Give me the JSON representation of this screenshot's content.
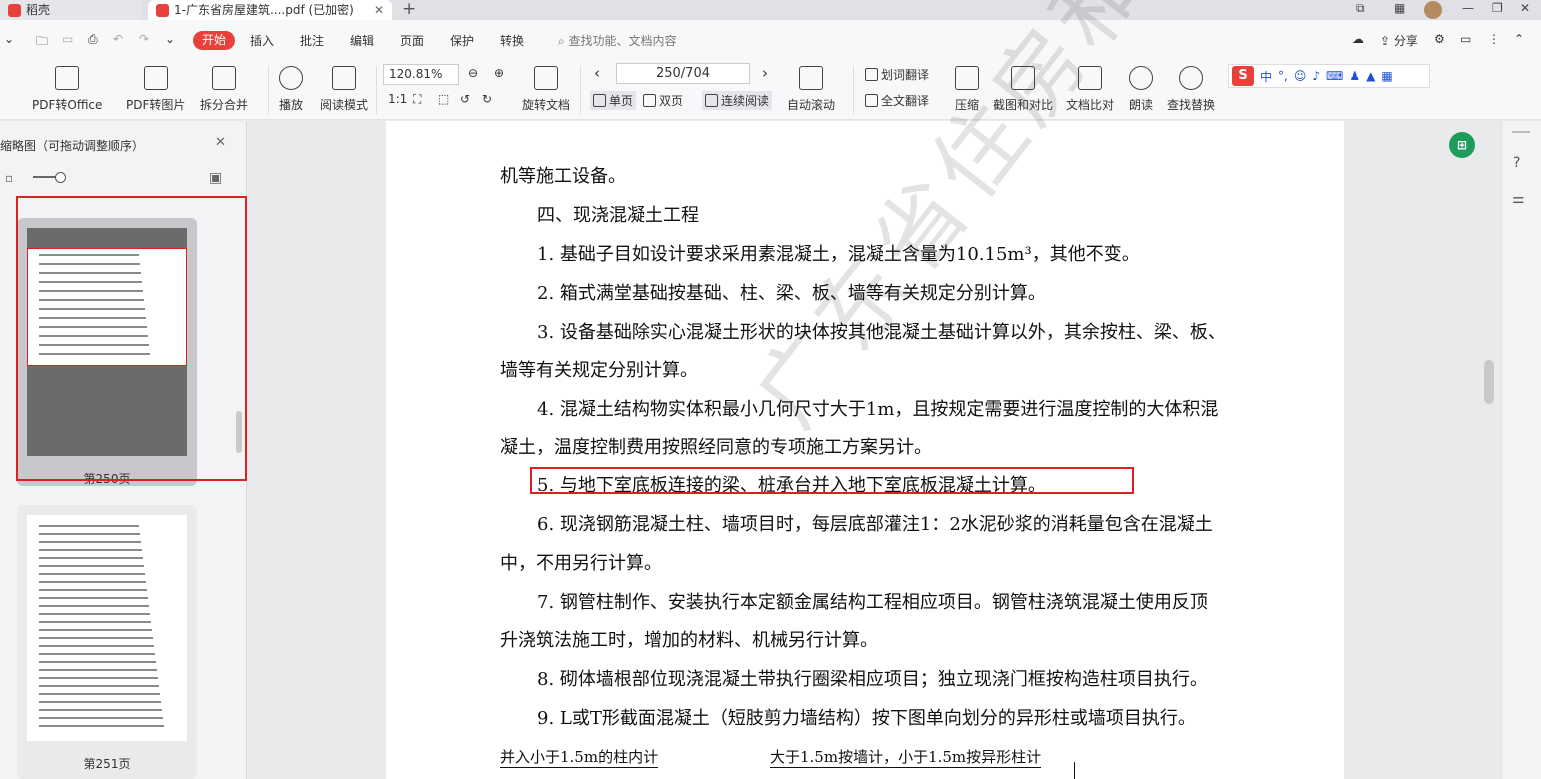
{
  "tabs": {
    "app": "稻壳",
    "document": "1-广东省房屋建筑....pdf (已加密)"
  },
  "menu": [
    "开始",
    "插入",
    "批注",
    "编辑",
    "页面",
    "保护",
    "转换"
  ],
  "search_placeholder": "查找功能、文档内容",
  "share_label": "分享",
  "toolbar": {
    "pdf_to_office": "PDF转Office",
    "pdf_to_image": "PDF转图片",
    "split_merge": "拆分合并",
    "play": "播放",
    "read_mode": "阅读模式",
    "zoom": "120.81%",
    "rotate": "旋转文档",
    "page_indicator": "250/704",
    "single_page": "单页",
    "double_page": "双页",
    "continuous": "连续阅读",
    "auto_scroll": "自动滚动",
    "word_translate": "划词翻译",
    "full_translate": "全文翻译",
    "compress": "压缩",
    "screenshot_compare": "截图和对比",
    "doc_compare": "文档比对",
    "read_aloud": "朗读",
    "find_replace": "查找替换"
  },
  "sidebar": {
    "title": "缩略图（可拖动调整顺序）",
    "thumbnails": [
      {
        "label": "第250页"
      },
      {
        "label": "第251页"
      }
    ]
  },
  "document": {
    "lines": [
      "机等施工设备。",
      "四、现浇混凝土工程",
      "1. 基础子目如设计要求采用素混凝土，混凝土含量为10.15m³，其他不变。",
      "2. 箱式满堂基础按基础、柱、梁、板、墙等有关规定分别计算。",
      "3. 设备基础除实心混凝土形状的块体按其他混凝土基础计算以外，其余按柱、梁、板、",
      "墙等有关规定分别计算。",
      "4. 混凝土结构物实体积最小几何尺寸大于1m，且按规定需要进行温度控制的大体积混",
      "凝土，温度控制费用按照经同意的专项施工方案另计。",
      "5. 与地下室底板连接的梁、桩承台并入地下室底板混凝土计算。",
      "6. 现浇钢筋混凝土柱、墙项目时，每层底部灌注1：2水泥砂浆的消耗量包含在混凝土",
      "中，不用另行计算。",
      "7. 钢管柱制作、安装执行本定额金属结构工程相应项目。钢管柱浇筑混凝土使用反顶",
      "升浇筑法施工时，增加的材料、机械另行计算。",
      "8. 砌体墙根部位现浇混凝土带执行圈梁相应项目；独立现浇门框按构造柱项目执行。",
      "9. L或T形截面混凝土（短肢剪力墙结构）按下图单向划分的异形柱或墙项目执行。"
    ],
    "figure_label_left": "并入小于1.5m的柱内计",
    "figure_label_right": "大于1.5m按墙计，小于1.5m按异形柱计",
    "watermark": "广东省住房和城乡建设厅"
  }
}
